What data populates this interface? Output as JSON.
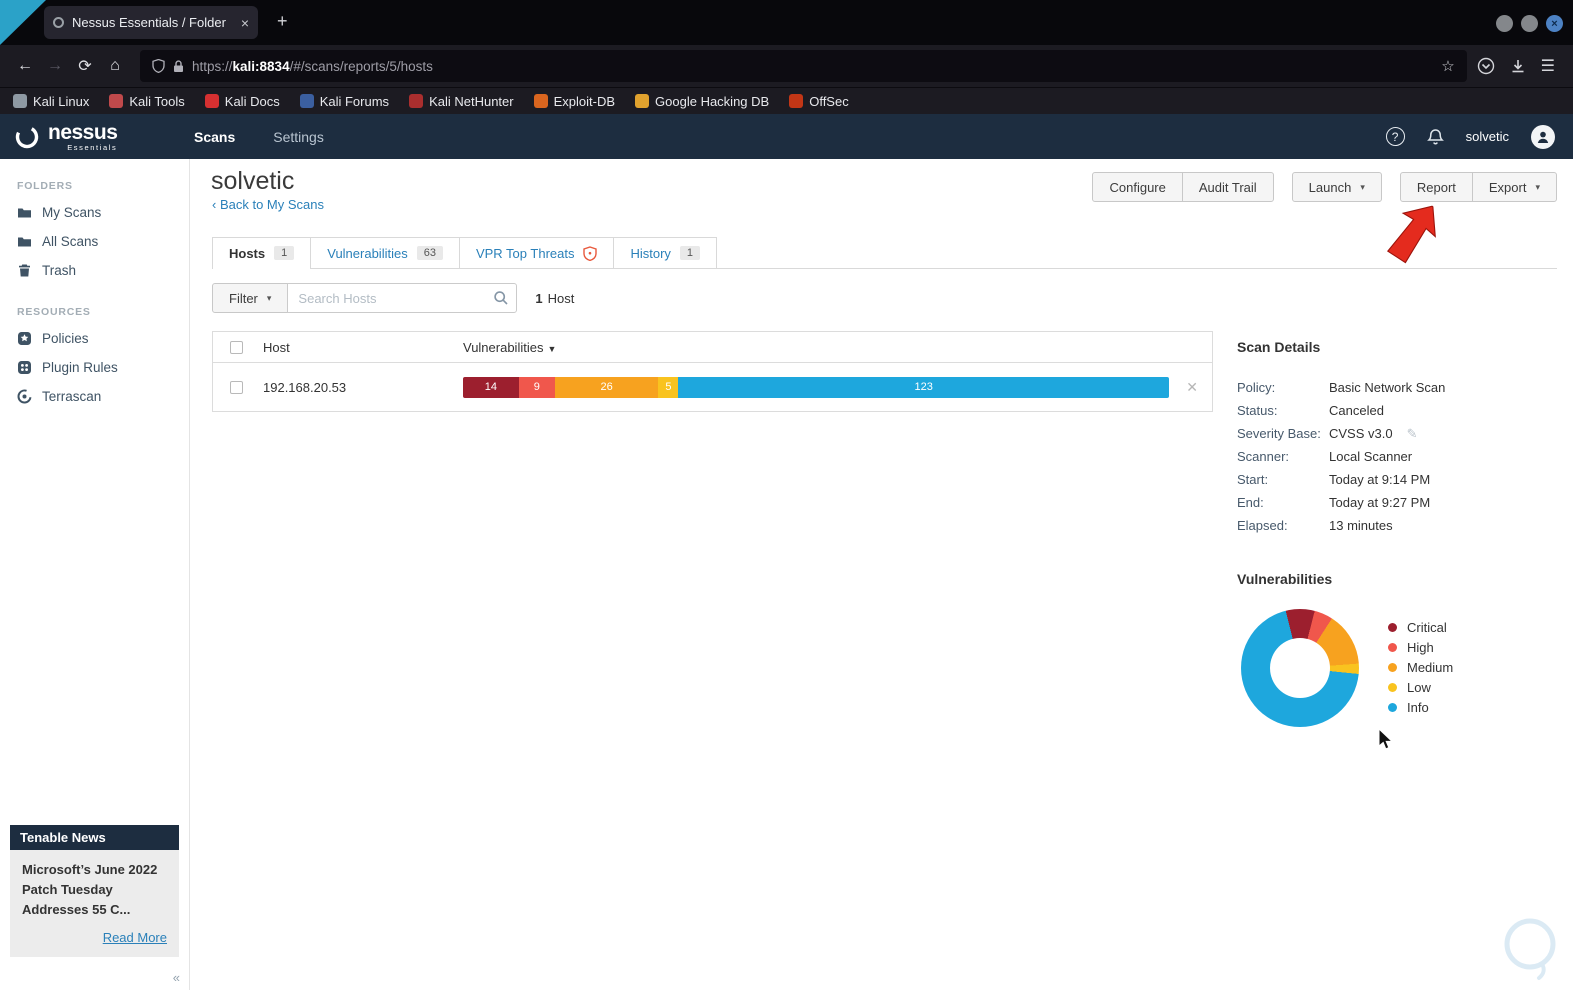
{
  "browser": {
    "tab": {
      "title": "Nessus Essentials / Folder",
      "close_glyph": "×"
    },
    "new_tab_glyph": "+",
    "window_close_glyph": "×",
    "nav": {
      "back": "←",
      "forward": "→",
      "reload": "⟳",
      "home": "⌂"
    },
    "url": {
      "prefix": "https://",
      "host": "kali:8834",
      "path": "/#/scans/reports/5/hosts"
    },
    "star_glyph": "☆",
    "menu_glyph": "☰",
    "bookmarks": [
      {
        "label": "Kali Linux",
        "color": "#8e99a3"
      },
      {
        "label": "Kali Tools",
        "color": "#c0494b"
      },
      {
        "label": "Kali Docs",
        "color": "#d63031"
      },
      {
        "label": "Kali Forums",
        "color": "#3b5fa0"
      },
      {
        "label": "Kali NetHunter",
        "color": "#aa2e2e"
      },
      {
        "label": "Exploit-DB",
        "color": "#d9651f"
      },
      {
        "label": "Google Hacking DB",
        "color": "#e0a22e"
      },
      {
        "label": "OffSec",
        "color": "#c23616"
      }
    ]
  },
  "app_header": {
    "brand": "nessus",
    "brand_sub": "Essentials",
    "nav_scans": "Scans",
    "nav_settings": "Settings",
    "help_glyph": "?",
    "username": "solvetic"
  },
  "sidebar": {
    "folders_label": "FOLDERS",
    "folders": [
      {
        "label": "My Scans"
      },
      {
        "label": "All Scans"
      },
      {
        "label": "Trash"
      }
    ],
    "resources_label": "RESOURCES",
    "resources": [
      {
        "label": "Policies"
      },
      {
        "label": "Plugin Rules"
      },
      {
        "label": "Terrascan"
      }
    ],
    "news": {
      "title": "Tenable News",
      "headline": "Microsoft’s June 2022 Patch Tuesday Addresses 55 C...",
      "read_more": "Read More"
    },
    "collapse_glyph": "«"
  },
  "main": {
    "title": "solvetic",
    "back_caret": "‹",
    "back_link": "Back to My Scans",
    "actions": {
      "configure": "Configure",
      "audit_trail": "Audit Trail",
      "launch": "Launch",
      "report": "Report",
      "export": "Export"
    },
    "caret_glyph": "▾",
    "tabs": [
      {
        "label": "Hosts",
        "badge": "1"
      },
      {
        "label": "Vulnerabilities",
        "badge": "63"
      },
      {
        "label": "VPR Top Threats"
      },
      {
        "label": "History",
        "badge": "1"
      }
    ],
    "filter_label": "Filter",
    "search_placeholder": "Search Hosts",
    "host_count": {
      "count": "1",
      "label": "Host"
    },
    "table": {
      "host_col": "Host",
      "vuln_col": "Vulnerabilities",
      "sort_glyph": "▼",
      "row_host": "192.168.20.53",
      "remove_glyph": "✕"
    }
  },
  "severities": [
    {
      "name": "Critical",
      "count": 14,
      "color": "#9c1f2e"
    },
    {
      "name": "High",
      "count": 9,
      "color": "#f0574c"
    },
    {
      "name": "Medium",
      "count": 26,
      "color": "#f7a21f"
    },
    {
      "name": "Low",
      "count": 5,
      "color": "#f9c31f"
    },
    {
      "name": "Info",
      "count": 123,
      "color": "#1ea7dd"
    }
  ],
  "scan_details": {
    "title": "Scan Details",
    "edit_glyph": "✎",
    "rows": [
      {
        "label": "Policy:",
        "value": "Basic Network Scan"
      },
      {
        "label": "Status:",
        "value": "Canceled"
      },
      {
        "label": "Severity Base:",
        "value": "CVSS v3.0"
      },
      {
        "label": "Scanner:",
        "value": "Local Scanner"
      },
      {
        "label": "Start:",
        "value": "Today at 9:14 PM"
      },
      {
        "label": "End:",
        "value": "Today at 9:27 PM"
      },
      {
        "label": "Elapsed:",
        "value": "13 minutes"
      }
    ]
  },
  "vulnerabilities_panel": {
    "title": "Vulnerabilities"
  },
  "chart_data": {
    "type": "pie",
    "donut": true,
    "title": "Vulnerabilities",
    "categories": [
      "Critical",
      "High",
      "Medium",
      "Low",
      "Info"
    ],
    "values": [
      14,
      9,
      26,
      5,
      123
    ],
    "colors": [
      "#9c1f2e",
      "#f0574c",
      "#f7a21f",
      "#f9c31f",
      "#1ea7dd"
    ],
    "legend_position": "right"
  }
}
